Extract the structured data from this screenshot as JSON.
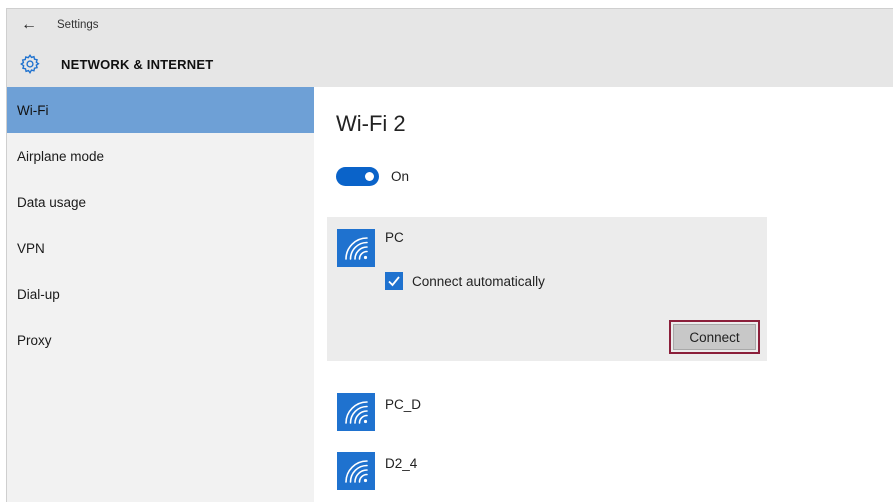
{
  "window": {
    "title": "Settings",
    "back_icon": "back-arrow-icon"
  },
  "header": {
    "section_title": "NETWORK & INTERNET",
    "section_icon": "gear-icon"
  },
  "sidebar": {
    "items": [
      {
        "label": "Wi-Fi",
        "active": true
      },
      {
        "label": "Airplane mode",
        "active": false
      },
      {
        "label": "Data usage",
        "active": false
      },
      {
        "label": "VPN",
        "active": false
      },
      {
        "label": "Dial-up",
        "active": false
      },
      {
        "label": "Proxy",
        "active": false
      }
    ]
  },
  "main": {
    "title": "Wi-Fi 2",
    "toggle": {
      "label": "On",
      "state": true
    },
    "networks": [
      {
        "name": "PC",
        "icon": "wifi-signal-icon",
        "expanded": true
      },
      {
        "name": "PC_D",
        "icon": "wifi-signal-icon",
        "expanded": false
      },
      {
        "name": "D2_4",
        "icon": "wifi-signal-icon",
        "expanded": false
      }
    ],
    "connect_automatically": {
      "label": "Connect automatically",
      "checked": true
    },
    "connect_button": "Connect"
  },
  "colors": {
    "accent": "#1f72cf",
    "toggle_on": "#0a63c9",
    "nav_active": "#6ea0d6",
    "highlight_border": "#8b1f3a",
    "header_bg": "#e6e6e6",
    "sidebar_bg": "#f2f2f2"
  }
}
